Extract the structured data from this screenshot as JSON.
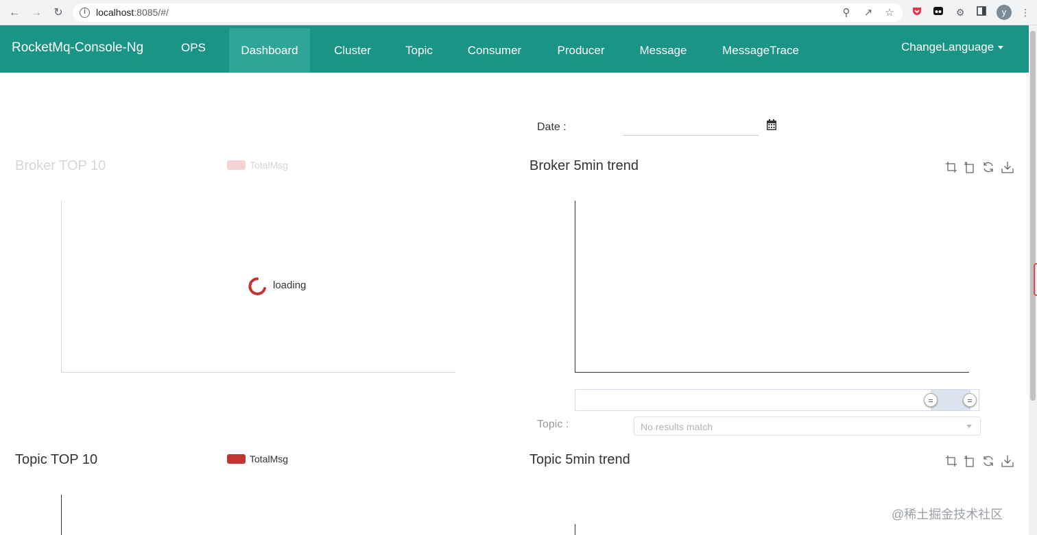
{
  "browser": {
    "url_host": "localhost",
    "url_rest": ":8085/#/",
    "profile_initial": "y"
  },
  "navbar": {
    "brand": "RocketMq-Console-Ng",
    "items": [
      {
        "label": "OPS"
      },
      {
        "label": "Dashboard",
        "active": true
      },
      {
        "label": "Cluster"
      },
      {
        "label": "Topic"
      },
      {
        "label": "Consumer"
      },
      {
        "label": "Producer"
      },
      {
        "label": "Message"
      },
      {
        "label": "MessageTrace"
      }
    ],
    "change_language": "ChangeLanguage"
  },
  "filters": {
    "date_label": "Date :",
    "date_value": "",
    "topic_label": "Topic :",
    "topic_select_value": "No results match"
  },
  "broker_top10": {
    "title": "Broker TOP 10",
    "legend": "TotalMsg",
    "loading_text": "loading"
  },
  "broker_trend": {
    "title": "Broker 5min trend"
  },
  "topic_top10": {
    "title": "Topic TOP 10",
    "legend": "TotalMsg"
  },
  "topic_trend": {
    "title": "Topic 5min trend"
  },
  "watermark": "@稀土掘金技术社区",
  "colors": {
    "navbar": "#1a9485",
    "nav_active": "#2ea596",
    "legend_red": "#c23531"
  }
}
